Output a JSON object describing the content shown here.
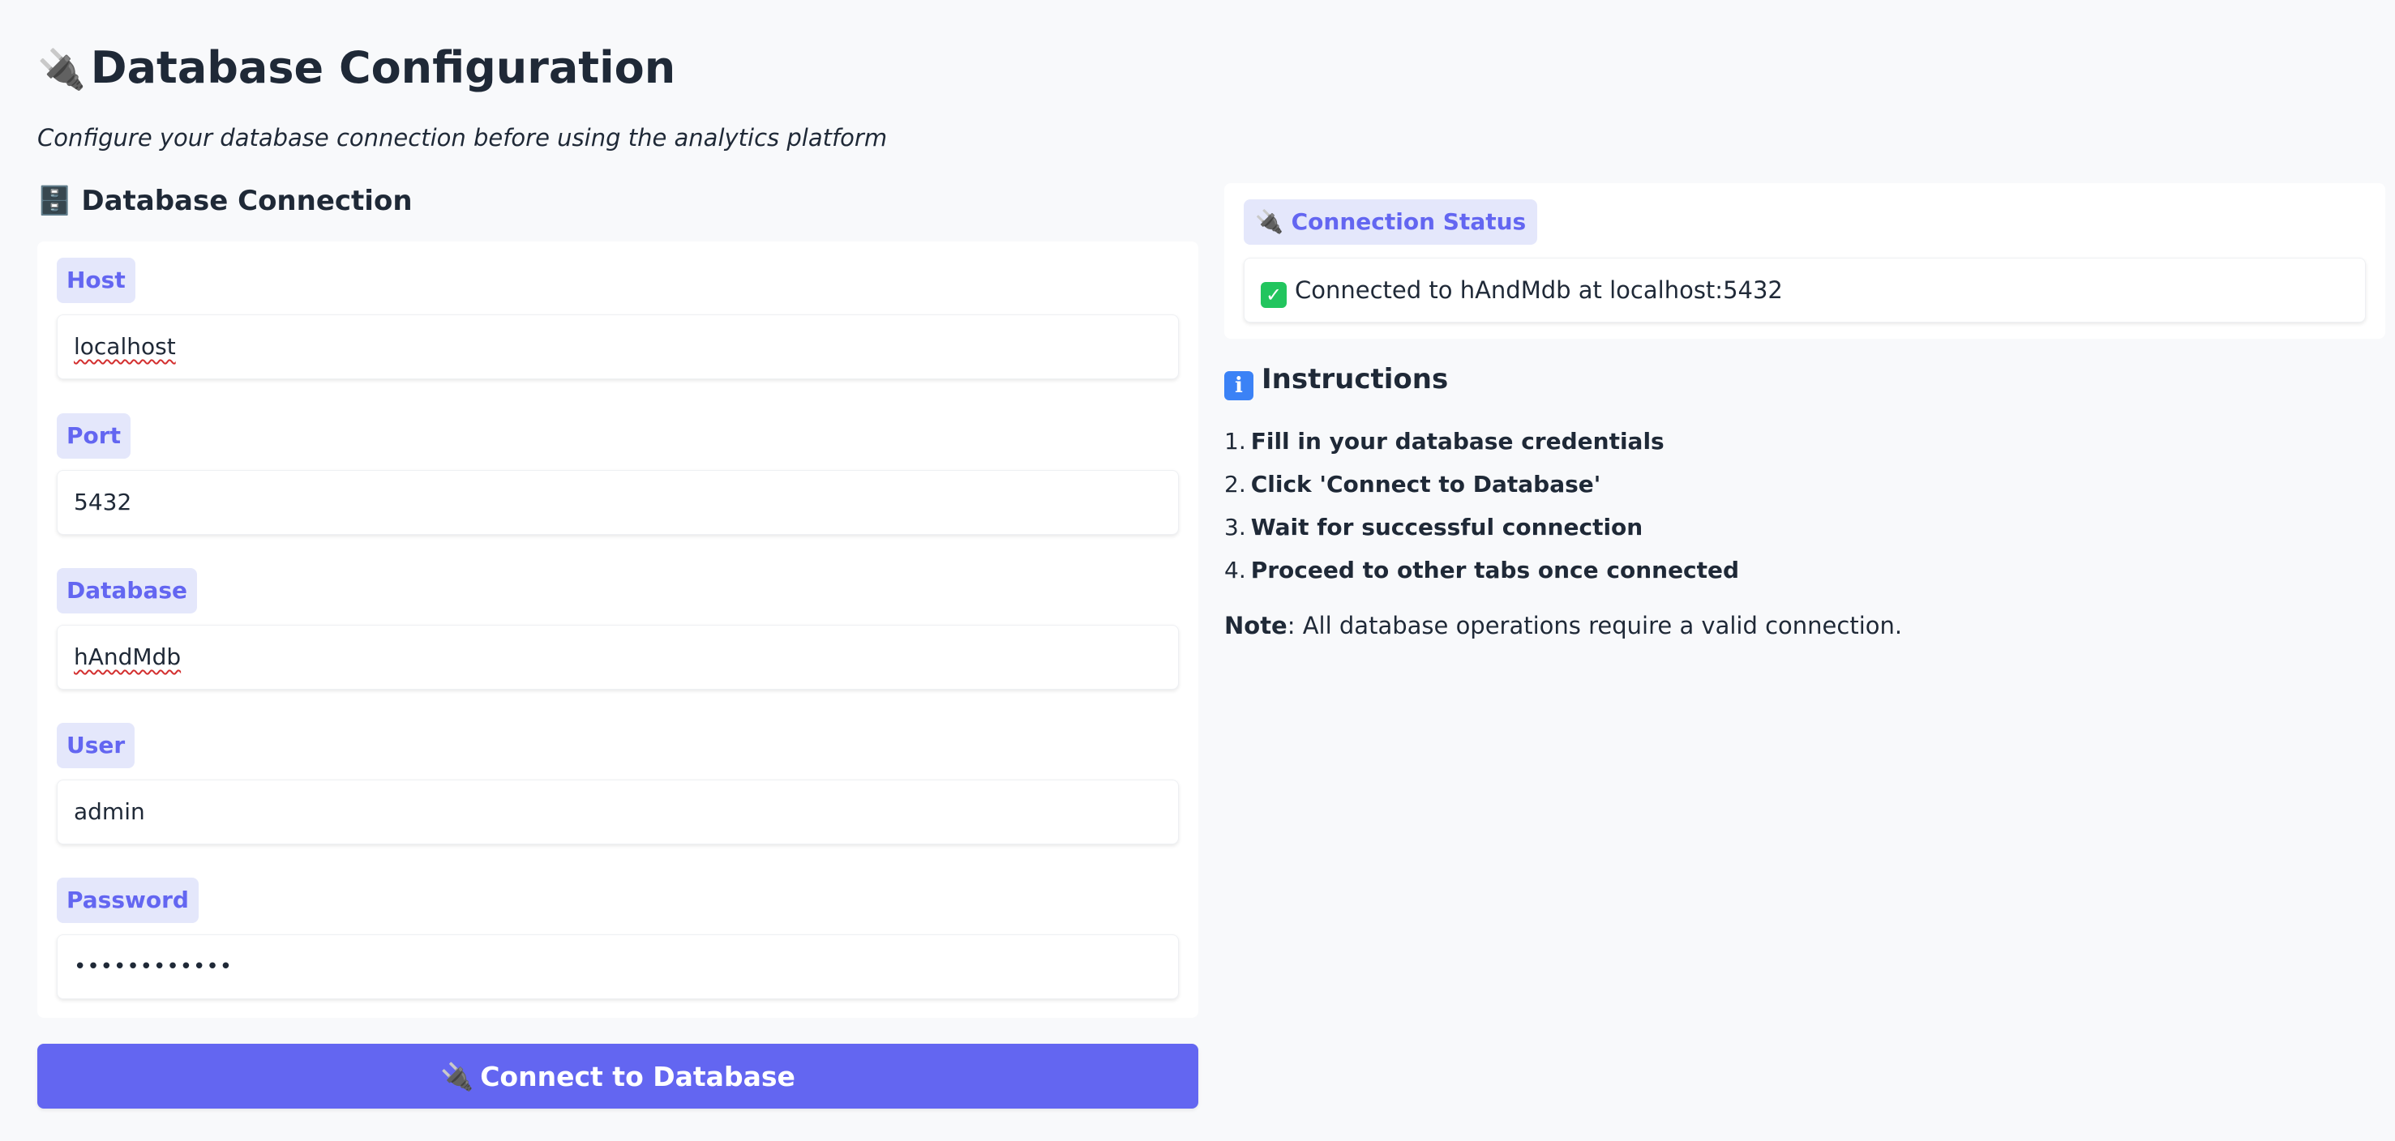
{
  "page": {
    "title": "Database Configuration",
    "title_icon": "🔌",
    "subtitle": "Configure your database connection before using the analytics platform"
  },
  "connection_section": {
    "heading": "Database Connection",
    "heading_icon": "🗄️",
    "fields": {
      "host": {
        "label": "Host",
        "value": "localhost"
      },
      "port": {
        "label": "Port",
        "value": "5432"
      },
      "database": {
        "label": "Database",
        "value": "hAndMdb"
      },
      "user": {
        "label": "User",
        "value": "admin"
      },
      "password": {
        "label": "Password",
        "value": "••••••••••••"
      }
    },
    "connect_button": {
      "label": "Connect to Database",
      "icon": "🔌"
    }
  },
  "status": {
    "label": "Connection Status",
    "label_icon": "🔌",
    "message": "Connected to hAndMdb at localhost:5432",
    "status_color": "#22c55e"
  },
  "instructions": {
    "heading": "Instructions",
    "heading_icon": "i",
    "steps": [
      {
        "num": "1.",
        "text": "Fill in your database credentials"
      },
      {
        "num": "2.",
        "text": "Click 'Connect to Database'"
      },
      {
        "num": "3.",
        "text": "Wait for successful connection"
      },
      {
        "num": "4.",
        "text": "Proceed to other tabs once connected"
      }
    ],
    "note_label": "Note",
    "note_text": ": All database operations require a valid connection."
  },
  "theme": {
    "accent": "#6366f1",
    "label_bg": "#e4e7fb",
    "page_bg": "#f8f9fb",
    "text": "#1f2937"
  }
}
